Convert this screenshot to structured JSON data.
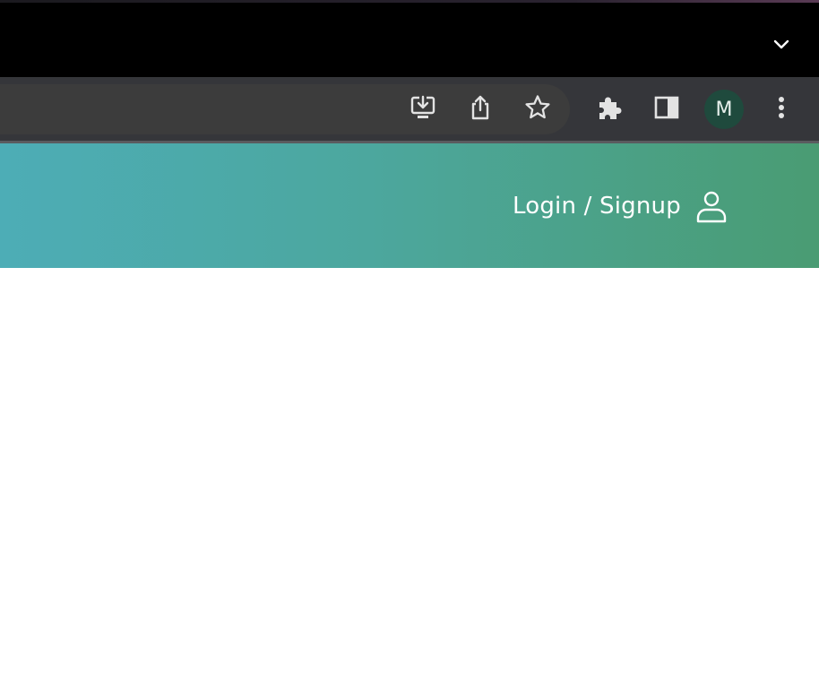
{
  "browser": {
    "profile_initial": "M",
    "colors": {
      "tabstrip": "#000000",
      "toolbar": "#35363a",
      "omnibox": "#3c3c3c",
      "avatar": "#1f4a3d",
      "icon": "#e3e3e3"
    },
    "tabstrip_icons": [
      "chevron-down-icon"
    ],
    "omnibox_icons": [
      "install-app-icon",
      "share-icon",
      "star-icon"
    ],
    "toolbar_icons": [
      "extensions-puzzle-icon",
      "side-panel-icon",
      "profile-avatar",
      "more-vert-icon"
    ]
  },
  "site": {
    "header": {
      "login_label": "Login / Signup",
      "login_icon": "user-icon",
      "gradient": [
        "#4dadb6",
        "#4a9c73"
      ]
    }
  }
}
